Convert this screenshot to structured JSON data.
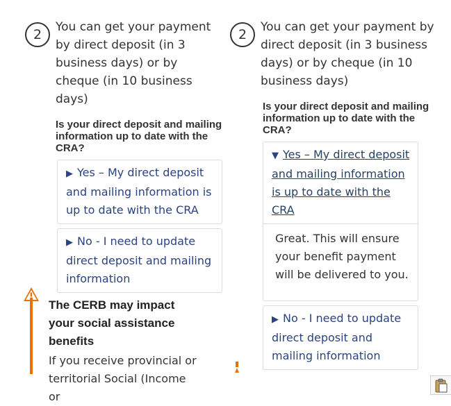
{
  "left": {
    "step_number": "2",
    "step_text": "You can get your payment by direct deposit (in 3 business days) or by cheque (in 10 business days)",
    "question": "Is your direct deposit and mailing information up to date with the CRA?",
    "accordions": [
      {
        "label": "Yes – My direct deposit and mailing information is up to date with the CRA",
        "open": false
      },
      {
        "label": "No - I need to update direct deposit and mailing information",
        "open": false
      }
    ]
  },
  "right": {
    "step_number": "2",
    "step_text": "You can get your payment by direct deposit (in 3 business days) or by cheque (in 10 business days)",
    "question": "Is your direct deposit and mailing information up to date with the CRA?",
    "accordions": [
      {
        "label": "Yes – My direct deposit and mailing information is up to date with the CRA",
        "open": true,
        "body": "Great. This will ensure your benefit payment will be delivered to you."
      },
      {
        "label": "No - I need to update direct deposit and mailing information",
        "open": false
      }
    ]
  },
  "alert": {
    "icon": "warning-icon",
    "title": "The CERB may impact your social assistance benefits",
    "text": "If you receive provincial or territorial Social (Income or"
  },
  "colors": {
    "link": "#2b4380",
    "alert_orange": "#ee7100",
    "border": "#dddddd"
  }
}
